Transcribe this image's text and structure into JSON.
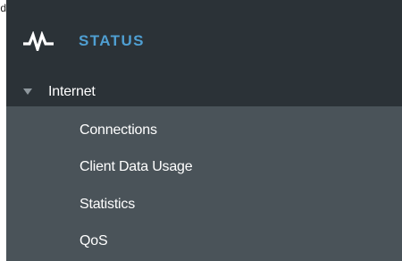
{
  "cutoff_text": "d",
  "sidebar": {
    "header": {
      "title": "STATUS",
      "icon": "activity-pulse-icon"
    },
    "group": {
      "label": "Internet",
      "expanded": true,
      "caret_icon": "caret-down-icon"
    },
    "items": [
      {
        "label": "Connections"
      },
      {
        "label": "Client Data Usage"
      },
      {
        "label": "Statistics"
      },
      {
        "label": "QoS"
      }
    ]
  },
  "colors": {
    "header_bg": "#2b3237",
    "panel_bg": "#4a5359",
    "accent": "#4f9fd2",
    "text": "#ffffff"
  }
}
